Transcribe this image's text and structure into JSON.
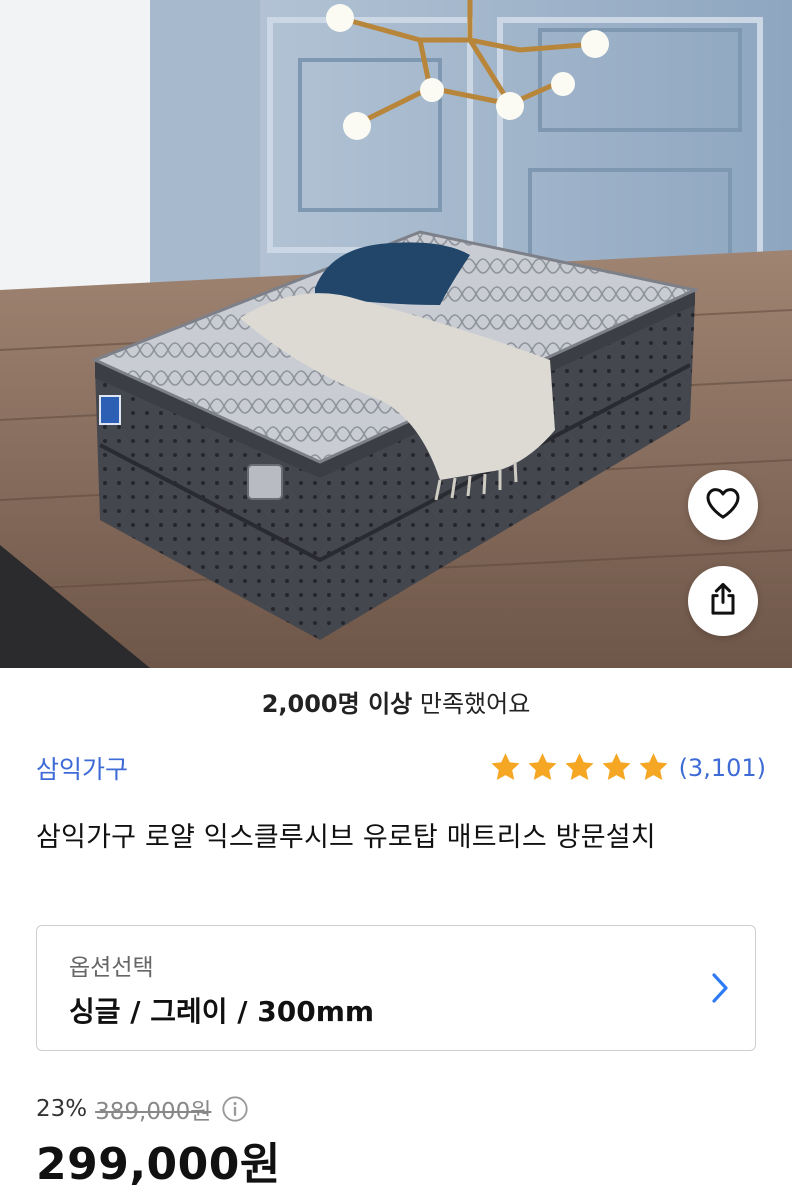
{
  "hero": {
    "image_alt": "mattress-product-photo",
    "actions": {
      "wishlist_icon": "heart-icon",
      "share_icon": "share-icon"
    }
  },
  "satisfaction": {
    "bold": "2,000명 이상",
    "rest": "만족했어요"
  },
  "product": {
    "brand": "삼익가구",
    "rating": {
      "stars": 5,
      "count": "(3,101)",
      "star_color": "#f5a623"
    },
    "title": "삼익가구 로얄 익스클루시브 유로탑 매트리스 방문설치"
  },
  "option": {
    "label": "옵션선택",
    "value": "싱글 / 그레이 / 300mm"
  },
  "price": {
    "discount": "23%",
    "original": "389,000원",
    "current": "299,000원"
  },
  "colors": {
    "accent": "#3e6bd6",
    "star": "#f5a623",
    "chevron": "#2f7cf6"
  }
}
